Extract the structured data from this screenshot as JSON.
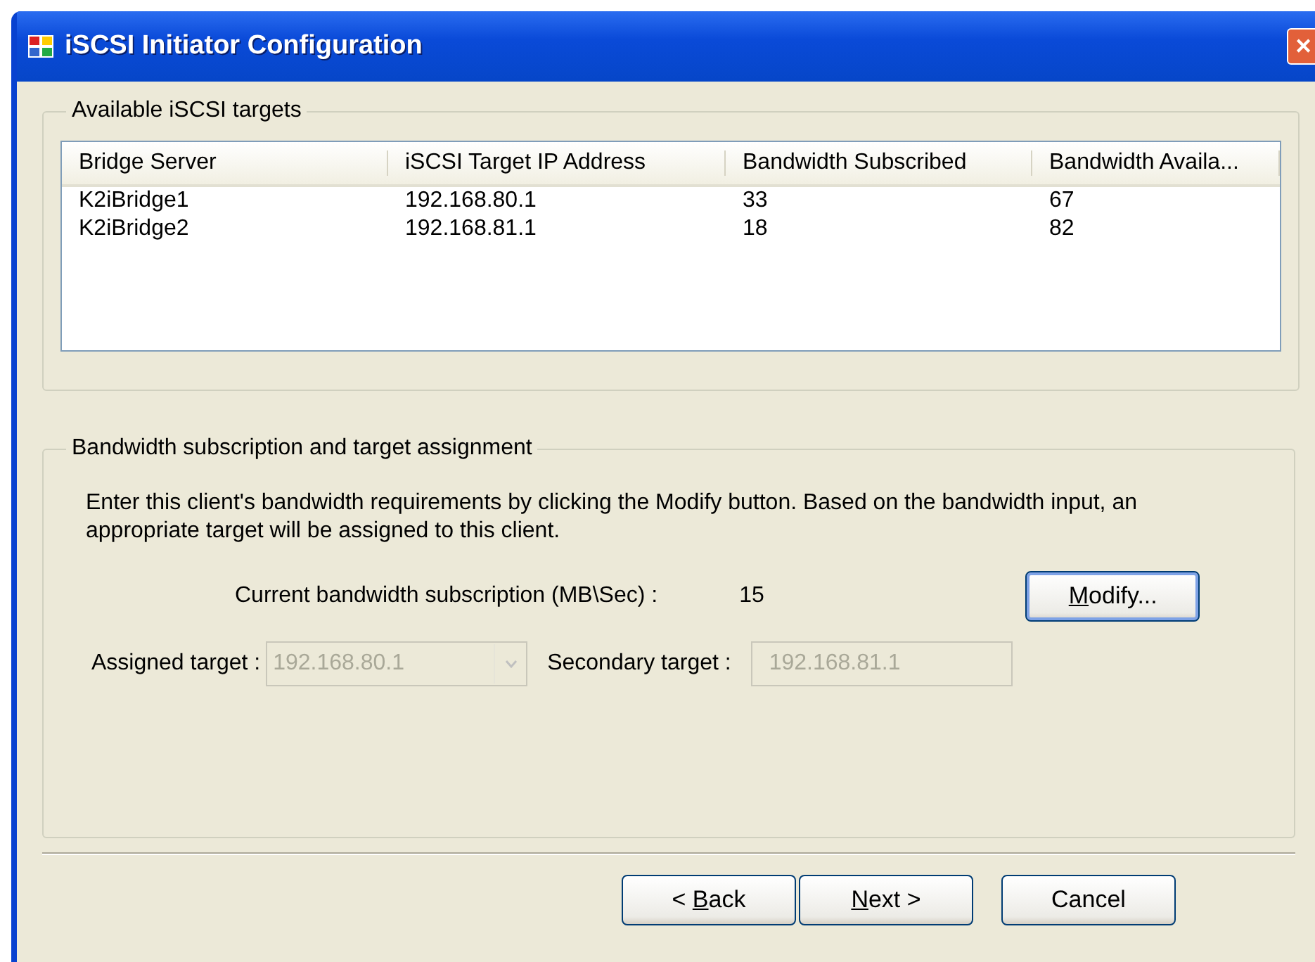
{
  "window": {
    "title": "iSCSI Initiator Configuration",
    "close": "✕"
  },
  "targets_group": {
    "title": "Available iSCSI targets",
    "table": {
      "columns": [
        "Bridge Server",
        "iSCSI Target IP Address",
        "Bandwidth Subscribed",
        "Bandwidth Availa..."
      ],
      "rows": [
        [
          "K2iBridge1",
          "192.168.80.1",
          "33",
          "67"
        ],
        [
          "K2iBridge2",
          "192.168.81.1",
          "18",
          "82"
        ]
      ]
    }
  },
  "subscription_group": {
    "title": "Bandwidth subscription and target assignment",
    "description": "Enter this client's bandwidth requirements by clicking the Modify button. Based on the bandwidth input, an appropriate target will be assigned to this client.",
    "current_label": "Current bandwidth subscription (MB\\Sec) :",
    "current_value": "15",
    "modify_button": {
      "key": "M",
      "post": "odify...",
      "default": true
    },
    "assigned_target": {
      "label": "Assigned target :",
      "value": "192.168.80.1",
      "disabled": true
    },
    "secondary_target": {
      "label": "Secondary target :",
      "value": "192.168.81.1",
      "disabled": true
    }
  },
  "buttons": [
    {
      "pre": "< ",
      "key": "B",
      "post": "ack"
    },
    {
      "key": "N",
      "post": "ext >"
    },
    {
      "pre": "Cancel"
    }
  ]
}
